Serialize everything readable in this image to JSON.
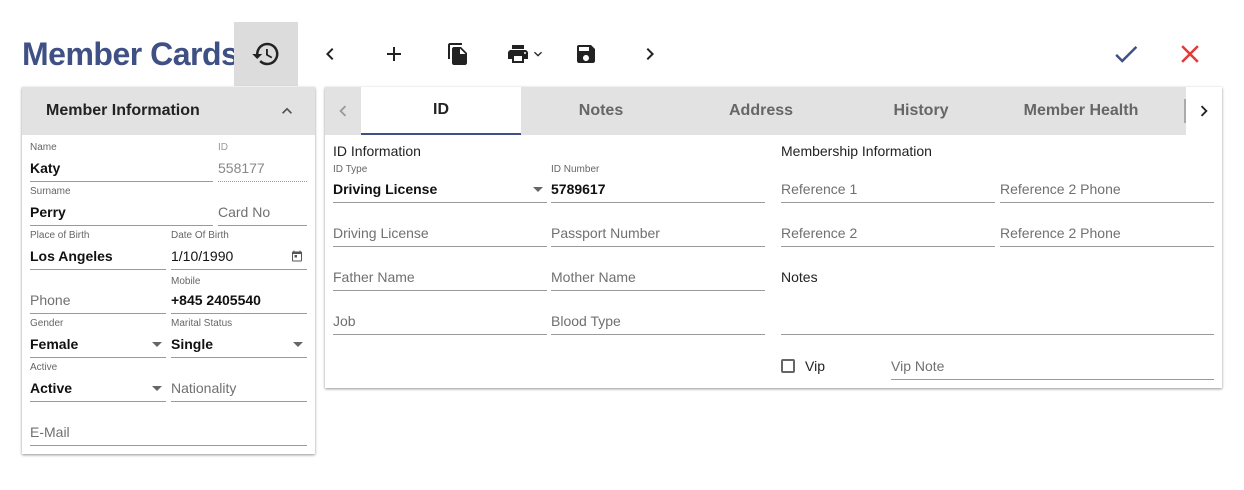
{
  "page": {
    "title": "Member Cards"
  },
  "toolbar": {
    "history_icon": "history-icon",
    "prev_icon": "chevron-left-icon",
    "add_icon": "add-icon",
    "copy_icon": "copy-icon",
    "print_icon": "print-icon",
    "save_icon": "save-icon",
    "next_icon": "chevron-right-icon",
    "confirm_icon": "check-icon",
    "close_icon": "close-icon"
  },
  "colors": {
    "brand": "#3f5085",
    "confirm": "#3f5085",
    "close": "#e53935",
    "header_bg": "#e2e2e2"
  },
  "member_info": {
    "title": "Member Information",
    "name": {
      "label": "Name",
      "value": "Katy"
    },
    "id": {
      "label": "ID",
      "value": "558177"
    },
    "surname": {
      "label": "Surname",
      "value": "Perry"
    },
    "card_no": {
      "placeholder": "Card No"
    },
    "place_of_birth": {
      "label": "Place of Birth",
      "value": "Los Angeles"
    },
    "date_of_birth": {
      "label": "Date Of Birth",
      "value": "1/10/1990"
    },
    "phone": {
      "placeholder": "Phone"
    },
    "mobile": {
      "label": "Mobile",
      "value": "+845 2405540"
    },
    "gender": {
      "label": "Gender",
      "value": "Female"
    },
    "marital_status": {
      "label": "Marital Status",
      "value": "Single"
    },
    "active": {
      "label": "Active",
      "value": "Active"
    },
    "nationality": {
      "placeholder": "Nationality"
    },
    "email": {
      "placeholder": "E-Mail"
    }
  },
  "tabs": [
    {
      "label": "ID",
      "active": true
    },
    {
      "label": "Notes"
    },
    {
      "label": "Address"
    },
    {
      "label": "History"
    },
    {
      "label": "Member Health"
    }
  ],
  "id_tab": {
    "id_information_title": "ID Information",
    "id_type": {
      "label": "ID Type",
      "value": "Driving License"
    },
    "id_number": {
      "label": "ID Number",
      "value": "5789617"
    },
    "driving_license": {
      "placeholder": "Driving License"
    },
    "passport_number": {
      "placeholder": "Passport Number"
    },
    "father_name": {
      "placeholder": "Father Name"
    },
    "mother_name": {
      "placeholder": "Mother Name"
    },
    "job": {
      "placeholder": "Job"
    },
    "blood_type": {
      "placeholder": "Blood Type"
    },
    "membership_information_title": "Membership Information",
    "reference_1": {
      "placeholder": "Reference 1"
    },
    "reference_2_phone_a": {
      "placeholder": "Reference 2 Phone"
    },
    "reference_2": {
      "placeholder": "Reference 2"
    },
    "reference_2_phone_b": {
      "placeholder": "Reference 2 Phone"
    },
    "notes": {
      "placeholder": "Notes"
    },
    "vip": {
      "label": "Vip",
      "checked": false
    },
    "vip_note": {
      "placeholder": "Vip Note"
    }
  }
}
